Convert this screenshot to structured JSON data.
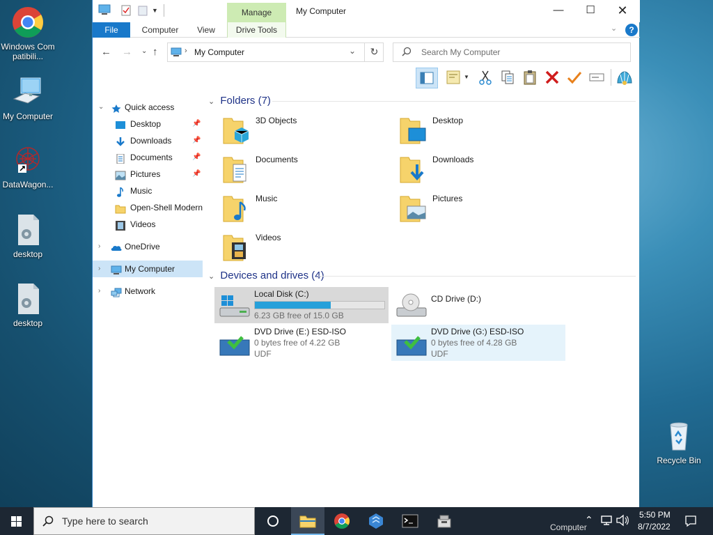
{
  "desktop": {
    "icons": [
      {
        "label": "Windows Compatibili..."
      },
      {
        "label": "My Computer"
      },
      {
        "label": "DataWagon..."
      },
      {
        "label": "desktop"
      },
      {
        "label": "desktop"
      },
      {
        "label": "Recycle Bin"
      }
    ]
  },
  "window": {
    "title": "My Computer",
    "contextual_tab_group": "Manage",
    "tabs": [
      "File",
      "Computer",
      "View",
      "Drive Tools"
    ],
    "address": {
      "current": "My Computer"
    },
    "search": {
      "placeholder": "Search My Computer"
    }
  },
  "nav": {
    "quick_access": "Quick access",
    "quick_items": [
      {
        "label": "Desktop",
        "pinned": true
      },
      {
        "label": "Downloads",
        "pinned": true
      },
      {
        "label": "Documents",
        "pinned": true
      },
      {
        "label": "Pictures",
        "pinned": true
      },
      {
        "label": "Music",
        "pinned": false
      },
      {
        "label": "Open-Shell Modern",
        "pinned": false
      },
      {
        "label": "Videos",
        "pinned": false
      }
    ],
    "onedrive": "OneDrive",
    "my_computer": "My Computer",
    "network": "Network"
  },
  "content": {
    "folders_header": "Folders (7)",
    "folders": [
      "3D Objects",
      "Desktop",
      "Documents",
      "Downloads",
      "Music",
      "Pictures",
      "Videos"
    ],
    "drives_header": "Devices and drives (4)",
    "drives": [
      {
        "name": "Local Disk (C:)",
        "free": "6.23 GB free of 15.0 GB",
        "used_fraction": 0.585,
        "fs": ""
      },
      {
        "name": "CD Drive (D:)",
        "free": "",
        "fs": ""
      },
      {
        "name": "DVD Drive (E:) ESD-ISO",
        "free": "0 bytes free of 4.22 GB",
        "fs": "UDF"
      },
      {
        "name": "DVD Drive (G:) ESD-ISO",
        "free": "0 bytes free of 4.28 GB",
        "fs": "UDF"
      }
    ]
  },
  "taskbar": {
    "search_placeholder": "Type here to search",
    "tray_label": "Computer",
    "time": "5:50 PM",
    "date": "8/7/2022"
  }
}
